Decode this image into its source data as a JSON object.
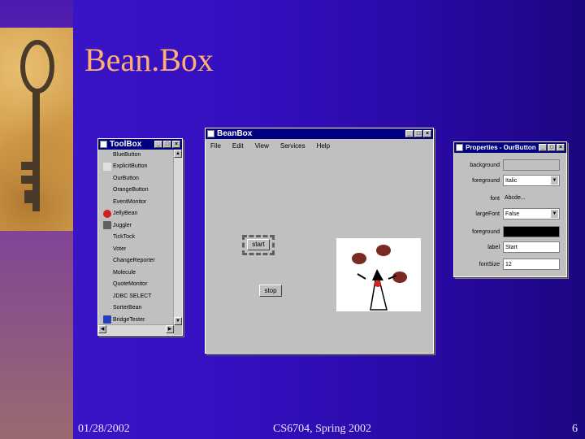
{
  "slide": {
    "title": "Bean.Box",
    "date": "01/28/2002",
    "course": "CS6704, Spring 2002",
    "page": "6"
  },
  "toolbox": {
    "title": "ToolBox",
    "items": [
      "BlueButton",
      "ExplicitButton",
      "OurButton",
      "OrangeButton",
      "EventMonitor",
      "JellyBean",
      "Juggler",
      "TickTock",
      "Voter",
      "ChangeReporter",
      "Molecule",
      "QuoteMonitor",
      "JDBC SELECT",
      "SorterBean",
      "BridgeTester"
    ]
  },
  "beanbox": {
    "title": "BeanBox",
    "menu": [
      "File",
      "Edit",
      "View",
      "Services",
      "Help"
    ],
    "start_button": "start",
    "stop_button": "stop"
  },
  "properties": {
    "title": "Properties - OurButton",
    "rows": [
      {
        "label": "background",
        "value": ""
      },
      {
        "label": "foreground",
        "value": "Italic"
      },
      {
        "label": "font",
        "value": "Abcde..."
      },
      {
        "label": "largeFont",
        "value": "False"
      },
      {
        "label": "foreground",
        "value": ""
      },
      {
        "label": "label",
        "value": "Start"
      },
      {
        "label": "fontSize",
        "value": "12"
      }
    ]
  },
  "colors": {
    "accent_title": "#ffb070",
    "titlebar": "#000080",
    "window": "#c0c0c0"
  }
}
